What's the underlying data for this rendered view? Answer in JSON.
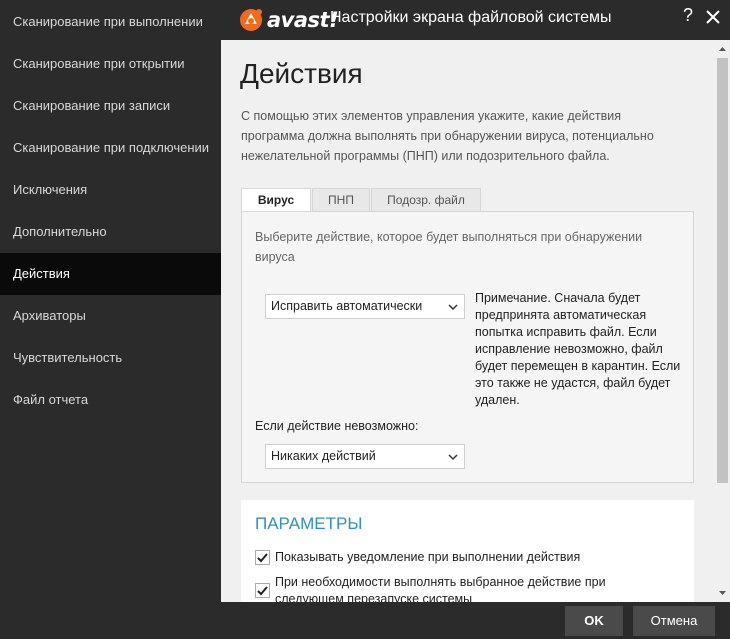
{
  "sidebar": {
    "items": [
      {
        "label": "Сканирование при выполнении",
        "active": false
      },
      {
        "label": "Сканирование при открытии",
        "active": false
      },
      {
        "label": "Сканирование при записи",
        "active": false
      },
      {
        "label": "Сканирование при подключении",
        "active": false
      },
      {
        "label": "Исключения",
        "active": false
      },
      {
        "label": "Дополнительно",
        "active": false
      },
      {
        "label": "Действия",
        "active": true
      },
      {
        "label": "Архиваторы",
        "active": false
      },
      {
        "label": "Чувствительность",
        "active": false
      },
      {
        "label": "Файл отчета",
        "active": false
      }
    ]
  },
  "window": {
    "logo_text": "avast!",
    "title": "Настройки экрана файловой системы",
    "help_label": "?"
  },
  "main": {
    "page_title": "Действия",
    "description": "С помощью этих элементов управления укажите, какие действия программа должна выполнять при обнаружении вируса, потенциально нежелательной программы (ПНП) или подозрительного файла.",
    "tabs": [
      {
        "label": "Вирус",
        "active": true
      },
      {
        "label": "ПНП",
        "active": false
      },
      {
        "label": "Подозр. файл",
        "active": false
      }
    ],
    "panel": {
      "prompt": "Выберите действие, которое будет выполняться при обнаружении вируса",
      "action_select": "Исправить автоматически",
      "note": "Примечание. Сначала будет предпринята автоматическая попытка исправить файл. Если исправление невозможно, файл будет перемещен в карантин. Если это также не удастся, файл будет удален.",
      "fallback_label": "Если действие невозможно:",
      "fallback_select": "Никаких действий"
    },
    "params": {
      "title": "ПАРАМЕТРЫ",
      "checkboxes": [
        {
          "label": "Показывать уведомление при выполнении действия",
          "checked": true
        },
        {
          "label": "При необходимости выполнять выбранное действие при следующем перезапуске системы",
          "checked": true
        }
      ]
    }
  },
  "footer": {
    "ok_label": "OK",
    "cancel_label": "Отмена"
  },
  "colors": {
    "sidebar_bg": "#2b2b2b",
    "active_item_bg": "#0a0a0a",
    "content_bg": "#f0f0f0",
    "accent_orange": "#f26a1b",
    "params_title": "#2f8fc9"
  }
}
